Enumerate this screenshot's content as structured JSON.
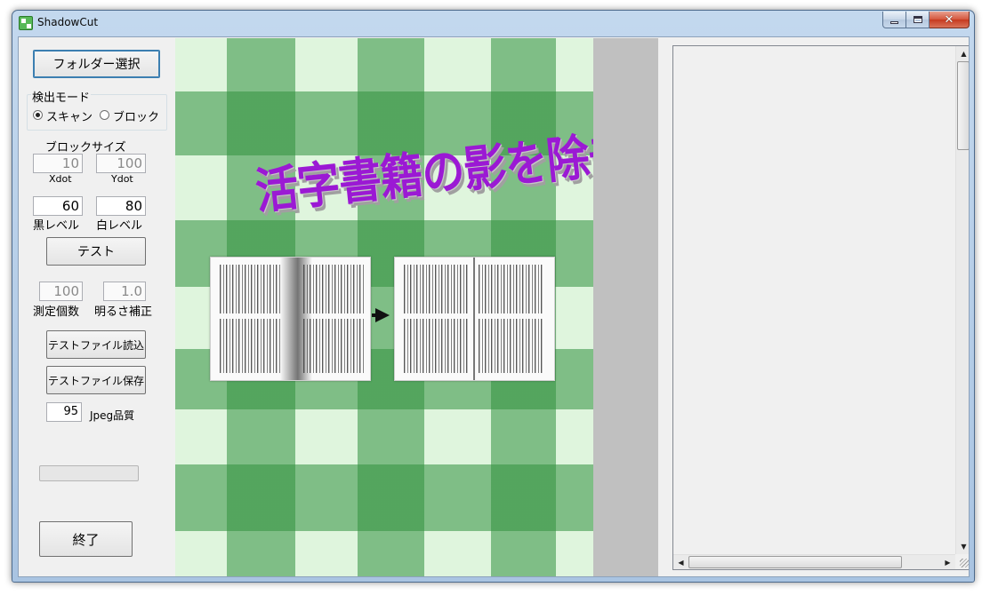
{
  "window": {
    "title": "ShadowCut",
    "controls": {
      "minimize": "minimize-icon",
      "maximize": "maximize-icon",
      "close": "✕"
    }
  },
  "left_panel": {
    "folder_button": "フォルダー選択",
    "detect_mode": {
      "legend": "検出モード",
      "options": [
        {
          "label": "スキャン",
          "checked": true
        },
        {
          "label": "ブロック",
          "checked": false
        }
      ]
    },
    "block_size": {
      "label": "ブロックサイズ",
      "x_value": "10",
      "y_value": "100",
      "x_caption": "Xdot",
      "y_caption": "Ydot"
    },
    "levels": {
      "black_value": "60",
      "white_value": "80",
      "black_label": "黒レベル",
      "white_label": "白レベル"
    },
    "test_button": "テスト",
    "measure": {
      "count_value": "100",
      "brightness_value": "1.0",
      "count_label": "測定個数",
      "brightness_label": "明るさ補正"
    },
    "load_test_button": "テストファイル読込",
    "save_test_button": "テストファイル保存",
    "jpeg": {
      "value": "95",
      "label": "Jpeg品質"
    },
    "exit_button": "終了"
  },
  "canvas": {
    "banner_text": "活字書籍の影を除去"
  },
  "colors": {
    "banner": "#9b19d4",
    "checker_dark": "#30913e",
    "checker_light": "#dff5dd",
    "strip": "#c0c0c0"
  }
}
